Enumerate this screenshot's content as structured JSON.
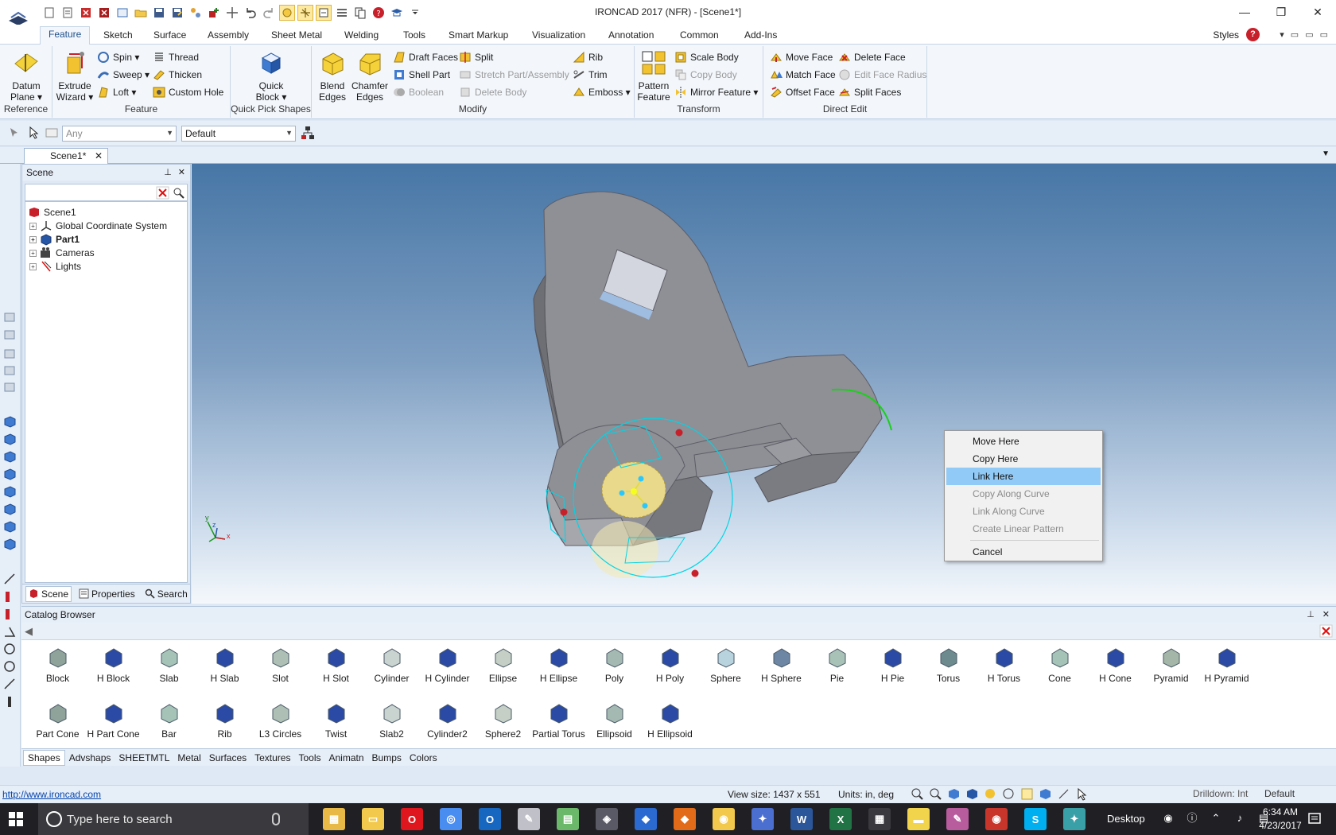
{
  "window": {
    "title": "IRONCAD 2017 (NFR) - [Scene1*]",
    "controls": [
      "—",
      "❐",
      "✕"
    ]
  },
  "ribbon": {
    "tabs": [
      "Feature",
      "Sketch",
      "Surface",
      "Assembly",
      "Sheet Metal",
      "Welding",
      "Tools",
      "Smart Markup",
      "Visualization",
      "Annotation",
      "Common",
      "Add-Ins"
    ],
    "active_tab": "Feature",
    "styles_label": "Styles",
    "help": "?",
    "groups": {
      "reference": {
        "label": "Reference",
        "datum_plane": "Datum Plane ▾"
      },
      "feature": {
        "label": "Feature",
        "extrude_wizard": "Extrude Wizard ▾",
        "spin": "Spin ▾",
        "sweep": "Sweep ▾",
        "loft": "Loft ▾",
        "thread": "Thread",
        "thicken": "Thicken",
        "custom_hole": "Custom Hole"
      },
      "quick_pick": {
        "label": "Quick Pick Shapes",
        "quick_block": "Quick Block ▾"
      },
      "modify": {
        "label": "Modify",
        "blend_edges": "Blend Edges",
        "chamfer_edges": "Chamfer Edges",
        "draft_faces": "Draft Faces",
        "shell_part": "Shell Part",
        "boolean": "Boolean",
        "split": "Split",
        "stretch_part": "Stretch Part/Assembly",
        "delete_body": "Delete Body",
        "rib": "Rib",
        "trim": "Trim",
        "emboss": "Emboss ▾"
      },
      "transform": {
        "label": "Transform",
        "pattern_feature": "Pattern Feature",
        "scale_body": "Scale Body",
        "copy_body": "Copy Body",
        "mirror_feature": "Mirror Feature ▾"
      },
      "direct_edit": {
        "label": "Direct Edit",
        "move_face": "Move Face",
        "match_face": "Match Face",
        "offset_face": "Offset Face",
        "delete_face": "Delete Face",
        "edit_face_radius": "Edit Face Radius",
        "split_faces": "Split Faces"
      }
    }
  },
  "selectbar": {
    "filter_value": "Any",
    "style_value": "Default"
  },
  "document": {
    "tab_label": "Scene1*"
  },
  "scene_panel": {
    "title": "Scene",
    "tree": [
      {
        "label": "Scene1",
        "bold": false
      },
      {
        "label": "Global Coordinate System",
        "bold": false
      },
      {
        "label": "Part1",
        "bold": true
      },
      {
        "label": "Cameras",
        "bold": false
      },
      {
        "label": "Lights",
        "bold": false
      }
    ],
    "tabs": [
      "Scene",
      "Properties",
      "Search"
    ]
  },
  "viewport": {
    "axis_labels": {
      "x": "x",
      "y": "y",
      "z": "z"
    }
  },
  "context_menu": {
    "items": [
      {
        "label": "Move Here",
        "enabled": true,
        "highlighted": false
      },
      {
        "label": "Copy Here",
        "enabled": true,
        "highlighted": false
      },
      {
        "label": "Link Here",
        "enabled": true,
        "highlighted": true
      },
      {
        "label": "Copy Along Curve",
        "enabled": false,
        "highlighted": false
      },
      {
        "label": "Link Along Curve",
        "enabled": false,
        "highlighted": false
      },
      {
        "label": "Create Linear Pattern",
        "enabled": false,
        "highlighted": false
      },
      {
        "label": "Cancel",
        "enabled": true,
        "highlighted": false
      }
    ]
  },
  "catalog": {
    "title": "Catalog Browser",
    "items": [
      "Block",
      "H Block",
      "Slab",
      "H Slab",
      "Slot",
      "H Slot",
      "Cylinder",
      "H Cylinder",
      "Ellipse",
      "H Ellipse",
      "Poly",
      "H Poly",
      "Sphere",
      "H Sphere",
      "Pie",
      "H Pie",
      "Torus",
      "H Torus",
      "Cone",
      "H Cone",
      "Pyramid",
      "H Pyramid",
      "Part Cone",
      "H Part Cone",
      "Bar",
      "Rib",
      "L3 Circles",
      "Twist",
      "Slab2",
      "Cylinder2",
      "Sphere2",
      "Partial Torus",
      "Ellipsoid",
      "H Ellipsoid"
    ],
    "tabs": [
      "Shapes",
      "Advshaps",
      "SHEETMTL",
      "Metal",
      "Surfaces",
      "Textures",
      "Tools",
      "Animatn",
      "Bumps",
      "Colors"
    ],
    "active_tab": "Shapes"
  },
  "status": {
    "url": "http://www.ironcad.com",
    "view_size": "View size: 1437 x  551",
    "units": "Units: in, deg",
    "drilldown": "Drilldown: Int",
    "default": "Default"
  },
  "taskbar": {
    "search_placeholder": "Type here to search",
    "desktop_label": "Desktop",
    "time": "6:34 AM",
    "date": "4/23/2017",
    "apps": [
      "file-explorer",
      "folder",
      "opera",
      "chrome",
      "outlook",
      "paint",
      "image-viewer",
      "ironcad",
      "app-blue",
      "app-orange",
      "app-yellow",
      "app-purple",
      "word",
      "excel",
      "calculator",
      "sticky-notes",
      "app-pen",
      "app-browser",
      "skype",
      "app-network"
    ],
    "colors": {
      "taskbar_bg": "#1f1f24",
      "search_bg": "#3a3a3e"
    }
  },
  "colors": {
    "accent": "#1f4f8b",
    "selection": "#91c9f7",
    "part_face": "#8f8f95",
    "triball": "#00d0e0"
  }
}
